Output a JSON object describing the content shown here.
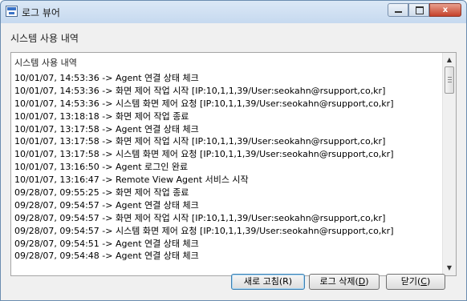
{
  "window": {
    "title": "로그 뷰어",
    "min_label": "",
    "max_label": "",
    "close_label": "x"
  },
  "section_label": "시스템 사용 내역",
  "log": {
    "header": "시스템 사용 내역",
    "rows": [
      "10/01/07, 14:53:36 -> Agent 연결 상태 체크",
      "10/01/07, 14:53:36 -> 화면 제어 작업 시작 [IP:10,1,1,39/User:seokahn@rsupport,co,kr]",
      "10/01/07, 14:53:36 -> 시스템 화면 제어 요청 [IP:10,1,1,39/User:seokahn@rsupport,co,kr]",
      "10/01/07, 13:18:18 -> 화면 제어 작업 종료",
      "10/01/07, 13:17:58 -> Agent 연결 상태 체크",
      "10/01/07, 13:17:58 -> 화면 제어 작업 시작 [IP:10,1,1,39/User:seokahn@rsupport,co,kr]",
      "10/01/07, 13:17:58 -> 시스템 화면 제어 요청 [IP:10,1,1,39/User:seokahn@rsupport,co,kr]",
      "10/01/07, 13:16:50 -> Agent 로그인 완료",
      "10/01/07, 13:16:47 -> Remote View Agent 서비스 시작",
      "09/28/07, 09:55:25 -> 화면 제어 작업 종료",
      "09/28/07, 09:54:57 -> Agent 연결 상태 체크",
      "09/28/07, 09:54:57 -> 화면 제어 작업 시작 [IP:10,1,1,39/User:seokahn@rsupport,co,kr]",
      "09/28/07, 09:54:57 -> 시스템 화면 제어 요청 [IP:10,1,1,39/User:seokahn@rsupport,co,kr]",
      "09/28/07, 09:54:51 -> Agent 연결 상태 체크",
      "09/28/07, 09:54:48 -> Agent 연결 상태 체크"
    ]
  },
  "buttons": {
    "refresh_label": "새로 고침(R)",
    "delete_prefix": "로그 삭제(",
    "delete_key": "D",
    "delete_suffix": ")",
    "close_prefix": "닫기(",
    "close_key": "C",
    "close_suffix": ")"
  }
}
